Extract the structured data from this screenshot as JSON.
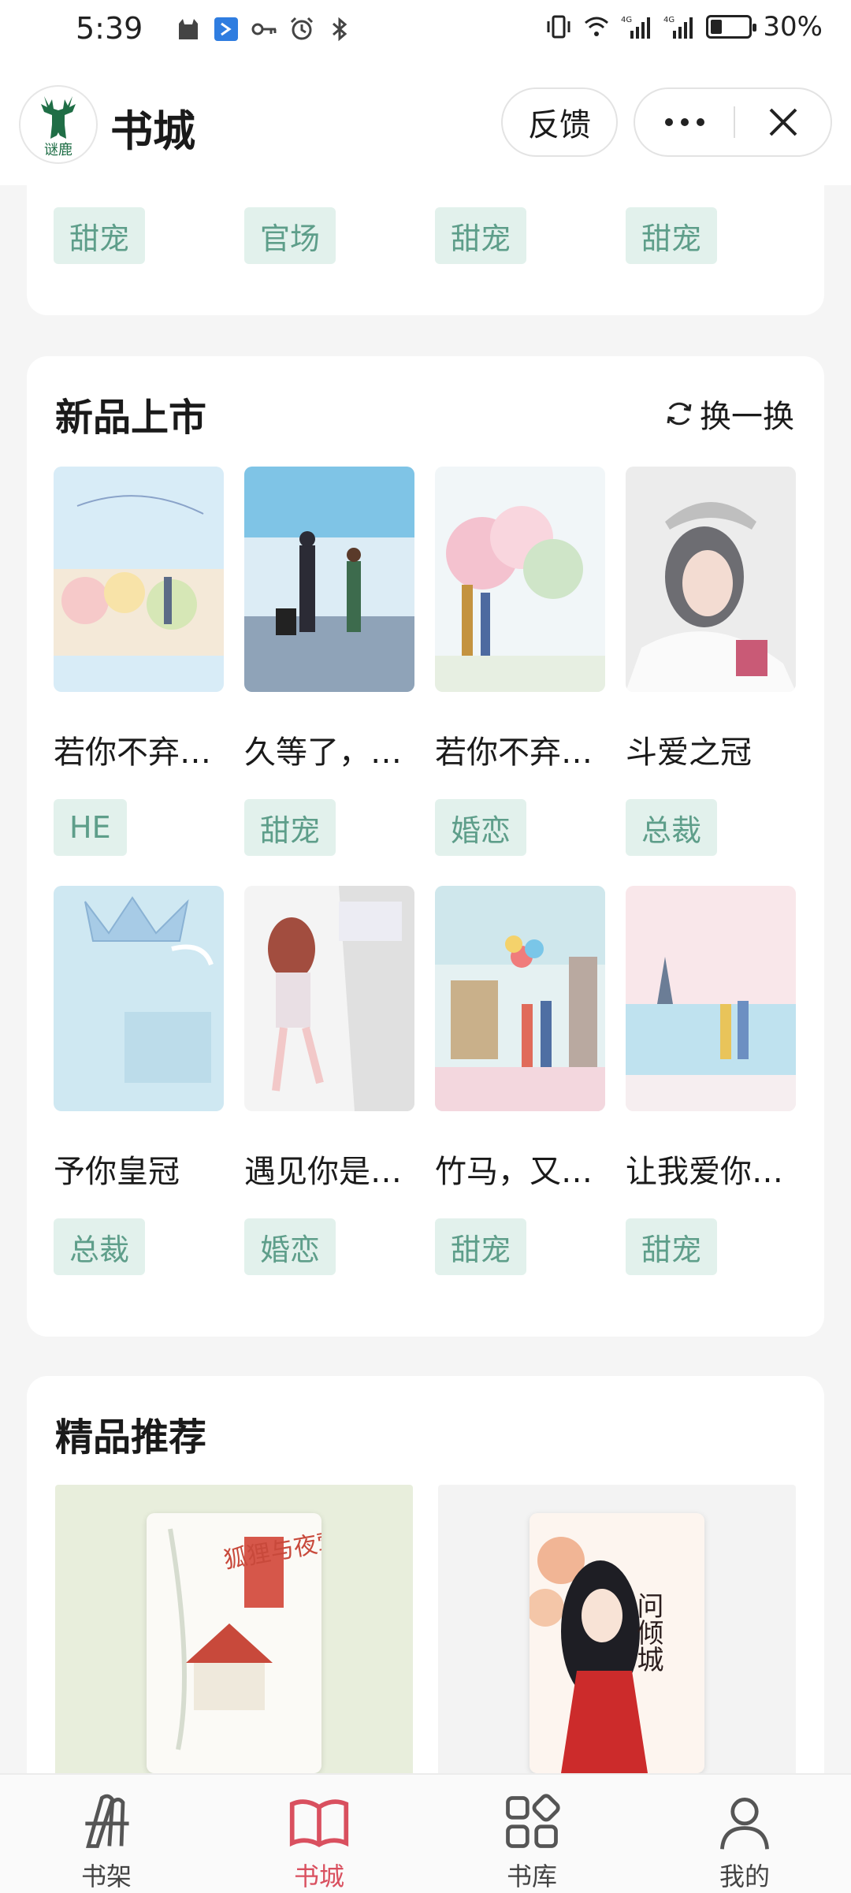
{
  "status_bar": {
    "time": "5:39",
    "battery": "30%",
    "battery_level": 0.3,
    "icons": [
      "cat-icon",
      "bluetooth-app-icon",
      "key-icon",
      "alarm-icon",
      "bluetooth-icon",
      "vibrate-icon",
      "wifi-icon",
      "signal-4g-icon",
      "signal-4g-icon",
      "battery-icon"
    ]
  },
  "header": {
    "logo_text": "谜鹿",
    "title": "书城",
    "feedback_label": "反馈"
  },
  "top_section": {
    "tags": [
      "甜宠",
      "官场",
      "甜宠",
      "甜宠"
    ]
  },
  "new_arrivals": {
    "title": "新品上市",
    "refresh_label": "换一换",
    "books": [
      {
        "title": "若你不弃，执手相依",
        "tag": "HE"
      },
      {
        "title": "久等了，机长大人",
        "tag": "甜宠"
      },
      {
        "title": "若你不弃，此生不离",
        "tag": "婚恋"
      },
      {
        "title": "斗爱之冠",
        "tag": "总裁"
      },
      {
        "title": "予你皇冠",
        "tag": "总裁"
      },
      {
        "title": "遇见你是我的幸运",
        "tag": "婚恋"
      },
      {
        "title": "竹马，又见竹马",
        "tag": "甜宠"
      },
      {
        "title": "让我爱你，不论朝夕",
        "tag": "甜宠"
      }
    ]
  },
  "premium": {
    "title": "精品推荐",
    "books": [
      {
        "cover_text": "狐狸与夜莺"
      },
      {
        "cover_text": "问倾城"
      }
    ]
  },
  "tabbar": {
    "items": [
      {
        "label": "书架",
        "icon": "bookshelf-icon"
      },
      {
        "label": "书城",
        "icon": "open-book-icon"
      },
      {
        "label": "书库",
        "icon": "grid-icon"
      },
      {
        "label": "我的",
        "icon": "user-icon"
      }
    ],
    "active_color": "#d9505f"
  },
  "colors": {
    "tag_bg": "#e2f1ec",
    "tag_text": "#5e9e8a",
    "accent": "#d9505f"
  }
}
